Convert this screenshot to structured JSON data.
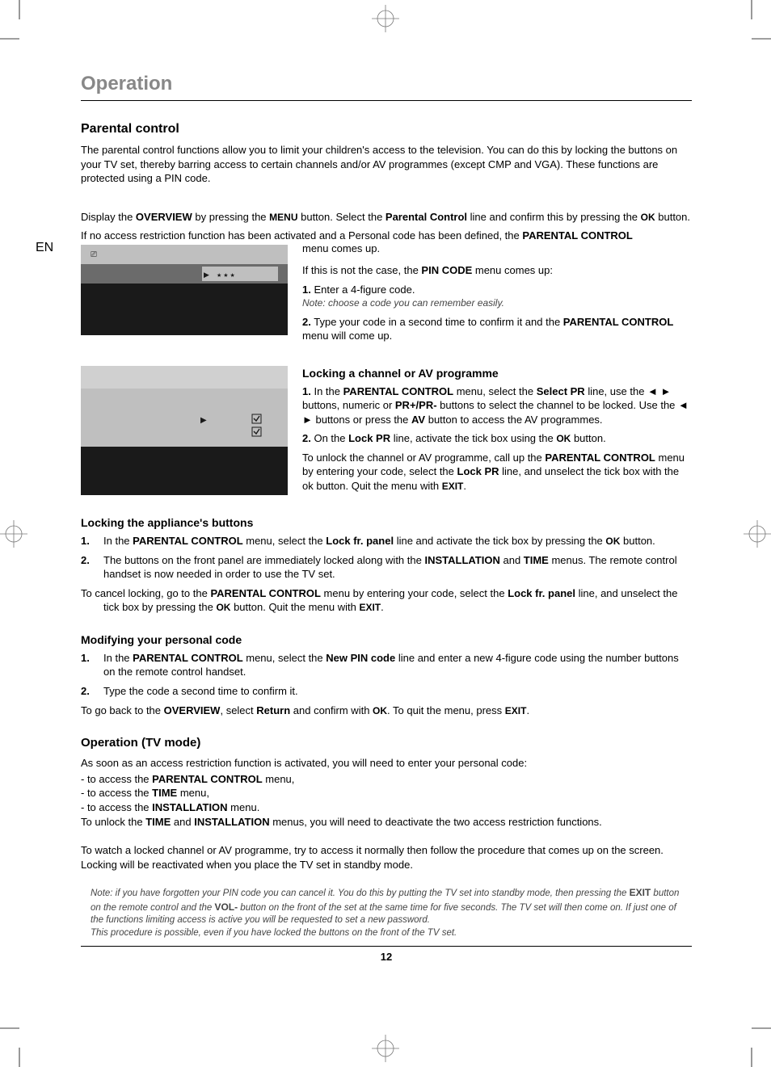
{
  "page_number": "12",
  "lang_tab": "EN",
  "title": "Operation",
  "sec_pc": {
    "h": "Parental control",
    "intro": "The parental control functions allow you to limit your children's access to the television. You can do this by locking the buttons on your TV set, thereby barring access to certain channels and/or AV programmes (except CMP and VGA). These functions are protected using a PIN code.",
    "display_prefix": "Display the ",
    "overview": "OVERVIEW",
    "display_mid1": " by pressing the ",
    "menu_btn": "MENU",
    "display_mid2": " button. Select the ",
    "pc_line": "Parental Control",
    "display_mid3": " line and confirm this by pressing the ",
    "ok_btn": "OK",
    "display_end": " button.",
    "noaccess_prefix": "If no access restriction function has been activated and a Personal code has been defined, the ",
    "pc_menu": "PARENTAL CONTROL",
    "noaccess_end": " menu comes up.",
    "notcase_prefix": "If this is not the case, the ",
    "pin_menu": "PIN CODE",
    "notcase_end": " menu comes up:",
    "step1_num": "1.",
    "step1_body": "Enter a 4-figure code.",
    "step1_note": "Note: choose a code you can remember easily.",
    "step2_num": "2.",
    "step2_prefix": "Type your code in a second time to confirm it and the ",
    "step2_pc": "PARENTAL CONTROL",
    "step2_end": " menu will come up."
  },
  "sec_lock_ch": {
    "h": "Locking a channel or AV programme",
    "s1_num": "1.",
    "s1_a": " In the ",
    "s1_b": "PARENTAL CONTROL",
    "s1_c": " menu, select the ",
    "s1_d": "Select PR",
    "s1_e": " line, use the ",
    "s1_f": " buttons, numeric or ",
    "s1_g": "PR+/PR-",
    "s1_h": " buttons to select the channel to be locked. Use the ",
    "s1_i": " buttons or press the ",
    "s1_j": "AV",
    "s1_k": " button to access the AV programmes.",
    "s2_num": "2.",
    "s2_a": " On the ",
    "s2_b": "Lock PR",
    "s2_c": " line, activate the tick box using the ",
    "s2_d": "OK",
    "s2_e": " button.",
    "unlock_a": "To unlock the channel or AV programme, call up the ",
    "unlock_b": "PARENTAL CONTROL",
    "unlock_c": " menu by entering your code, select the ",
    "unlock_d": "Lock PR",
    "unlock_e": " line, and unselect the tick box with the ok button. Quit the menu with ",
    "unlock_f": "EXIT",
    "unlock_g": "."
  },
  "sec_lock_btn": {
    "h": "Locking the appliance's buttons",
    "s1_num": "1.",
    "s1_a": "In the ",
    "s1_b": "PARENTAL CONTROL",
    "s1_c": " menu, select the ",
    "s1_d": "Lock fr. panel",
    "s1_e": " line and activate the tick box by pressing the ",
    "s1_f": "OK",
    "s1_g": " button.",
    "s2_num": "2.",
    "s2_a": "The buttons on the front panel are immediately locked along with the ",
    "s2_b": "INSTALLATION",
    "s2_c": " and ",
    "s2_d": "TIME",
    "s2_e": " menus. The remote control handset is now needed in order to use the TV set.",
    "cancel_a": "To cancel locking, go to the ",
    "cancel_b": "PARENTAL CONTROL",
    "cancel_c": " menu by entering your code, select the ",
    "cancel_d": "Lock fr. panel",
    "cancel_e": " line, and unselect the tick box by pressing the ",
    "cancel_f": "OK",
    "cancel_g": " button. Quit the menu with ",
    "cancel_h": "EXIT",
    "cancel_i": "."
  },
  "sec_mod_code": {
    "h": "Modifying your personal code",
    "s1_num": "1.",
    "s1_a": "In the ",
    "s1_b": "PARENTAL CONTROL",
    "s1_c": " menu, select the ",
    "s1_d": "New PIN code",
    "s1_e": " line and enter a new 4-figure code using the number buttons on the remote control handset.",
    "s2_num": "2.",
    "s2_a": "Type the code a second time to confirm it.",
    "back_a": "To go back to the ",
    "back_b": "OVERVIEW",
    "back_c": ", select ",
    "back_d": "Return",
    "back_e": " and confirm with ",
    "back_f": "OK",
    "back_g": ". To quit the menu, press ",
    "back_h": "EXIT",
    "back_i": "."
  },
  "sec_op": {
    "h": "Operation (TV mode)",
    "intro": "As soon as an access restriction function is activated, you will need to enter your personal code:",
    "li1_a": "- to access the ",
    "li1_b": "PARENTAL CONTROL",
    "li1_c": " menu,",
    "li2_a": "- to access the ",
    "li2_b": "TIME",
    "li2_c": " menu,",
    "li3_a": "- to access the ",
    "li3_b": "INSTALLATION",
    "li3_c": " menu.",
    "unlock_a": "To unlock the ",
    "unlock_b": "TIME",
    "unlock_c": " and ",
    "unlock_d": "INSTALLATION",
    "unlock_e": " menus, you will need to deactivate the two access restriction functions.",
    "watch": "To watch a locked channel or AV programme, try to access it normally then follow the procedure that comes up on the screen. Locking will be reactivated when you place the TV set in standby mode.",
    "note_a": "Note: if you have forgotten your PIN code you can cancel it. You do this by putting the TV set into standby mode, then pressing the ",
    "note_b": "EXIT",
    "note_c": " button on the remote control and the ",
    "note_d": "VOL-",
    "note_e": " button on the front of the set at the same time for five seconds. The TV set will then come on. If just one of the functions limiting access is active you will be requested to set a new password.",
    "note_f": "This procedure is possible, even if you have locked the buttons on the front of the TV set."
  }
}
